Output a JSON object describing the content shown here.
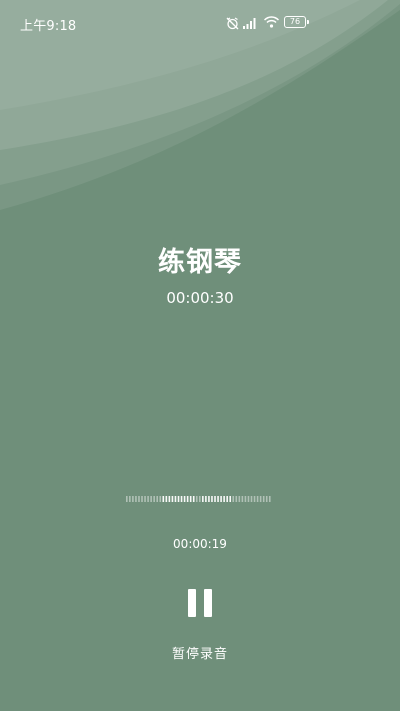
{
  "status_bar": {
    "time": "上午9:18",
    "battery_level": "76",
    "icons": [
      "alarm-off-icon",
      "signal-icon",
      "wifi-icon",
      "battery-icon"
    ]
  },
  "recording": {
    "title": "练钢琴",
    "total_duration": "00:00:30",
    "elapsed": "00:00:19",
    "progress_fraction": 0.63
  },
  "controls": {
    "pause_label": "暂停录音",
    "pause_icon": "pause-icon"
  },
  "colors": {
    "background": "#6f8f7a",
    "text": "#ffffff"
  }
}
